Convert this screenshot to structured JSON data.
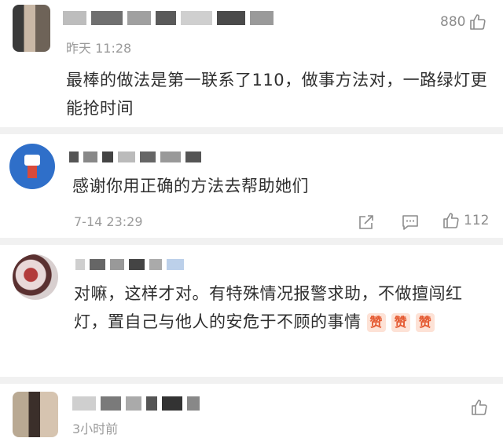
{
  "comments": [
    {
      "time": "昨天 11:28",
      "text": "最棒的做法是第一联系了110，做事方法对，一路绿灯更能抢时间",
      "like_count": "880",
      "icons": [
        "avatar",
        "thumb-up-icon"
      ]
    },
    {
      "time": "7-14 23:29",
      "text": "感谢你用正确的方法去帮助她们",
      "like_count": "112",
      "icons": [
        "avatar",
        "share-icon",
        "comment-icon",
        "thumb-up-icon"
      ]
    },
    {
      "text": "对嘛，这样才对。有特殊情况报警求助，不做擅闯红灯，置自己与他人的安危于不顾的事情",
      "emoji_label": "赞",
      "icons": [
        "avatar",
        "zan-emoji"
      ]
    },
    {
      "time": "3小时前",
      "icons": [
        "avatar",
        "thumb-up-icon"
      ]
    }
  ],
  "colors": {
    "divider": "#f1f1f1",
    "emoji_bg": "#fde2d6",
    "emoji_fg": "#e4572e",
    "muted": "#9b9b9b"
  }
}
